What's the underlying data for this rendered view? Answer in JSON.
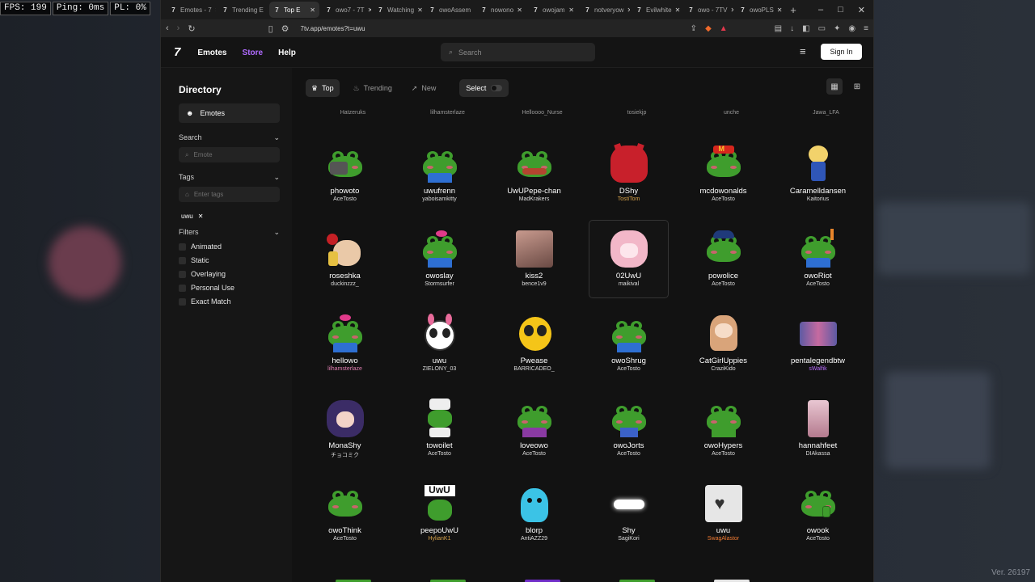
{
  "hud": {
    "fps": "FPS: 199",
    "ping": "Ping: 0ms",
    "pl": "PL: 0%"
  },
  "version": "Ver. 26197",
  "browser": {
    "tabs": [
      "Emotes - 7",
      "Trending E",
      "Top E",
      "owo7 - 7T",
      "Watching",
      "owoAssem",
      "nowono",
      "owojam",
      "notveryow",
      "Evilwhite",
      "owo - 7TV",
      "owoPLS"
    ],
    "active_tab_index": 2,
    "url": "7tv.app/emotes?t=uwu"
  },
  "site": {
    "logo": "7",
    "nav": [
      "Emotes",
      "Store",
      "Help"
    ],
    "search_placeholder": "Search",
    "sign_in": "Sign In"
  },
  "sidebar": {
    "title": "Directory",
    "item": "Emotes",
    "search_label": "Search",
    "search_placeholder": "Emote",
    "tags_label": "Tags",
    "tags_placeholder": "Enter tags",
    "tag_chip": "uwu",
    "filters_label": "Filters",
    "filters": [
      "Animated",
      "Static",
      "Overlaying",
      "Personal Use",
      "Exact Match"
    ]
  },
  "content": {
    "tabs": [
      "Top",
      "Trending",
      "New"
    ],
    "select_label": "Select",
    "cut_row": [
      "Hatzeruks",
      "lilhamsterlaze",
      "Helloooo_Nurse",
      "tosiekjp",
      "unche",
      "Jawa_LFA"
    ],
    "emotes": [
      {
        "name": "phowoto",
        "author": "AceTosto",
        "style": ""
      },
      {
        "name": "uwufrenn",
        "author": "yaboisamkitty",
        "style": ""
      },
      {
        "name": "UwUPepe-chan",
        "author": "MadKrakers",
        "style": ""
      },
      {
        "name": "DShy",
        "author": "TostiTom",
        "style": "gold"
      },
      {
        "name": "mcdowonalds",
        "author": "AceTosto",
        "style": ""
      },
      {
        "name": "Caramelldansen",
        "author": "Kaitorius",
        "style": ""
      },
      {
        "name": "roseshka",
        "author": "duckinzzz_",
        "style": ""
      },
      {
        "name": "owoslay",
        "author": "Stormsurfer",
        "style": ""
      },
      {
        "name": "kiss2",
        "author": "bence1v9",
        "style": ""
      },
      {
        "name": "02UwU",
        "author": "maikival",
        "style": ""
      },
      {
        "name": "powolice",
        "author": "AceTosto",
        "style": ""
      },
      {
        "name": "owoRiot",
        "author": "AceTosto",
        "style": ""
      },
      {
        "name": "hellowo",
        "author": "lilhamsterlaze",
        "style": "pink"
      },
      {
        "name": "uwu",
        "author": "ZIELONY_03",
        "style": ""
      },
      {
        "name": "Pwease",
        "author": "BARRICADEO_",
        "style": ""
      },
      {
        "name": "owoShrug",
        "author": "AceTosto",
        "style": ""
      },
      {
        "name": "CatGirlUppies",
        "author": "CraziKido",
        "style": ""
      },
      {
        "name": "pentalegendbtw",
        "author": "sWalfik",
        "style": "purple"
      },
      {
        "name": "MonaShy",
        "author": "チョコミク",
        "style": ""
      },
      {
        "name": "towoilet",
        "author": "AceTosto",
        "style": ""
      },
      {
        "name": "loveowo",
        "author": "AceTosto",
        "style": ""
      },
      {
        "name": "owoJorts",
        "author": "AceTosto",
        "style": ""
      },
      {
        "name": "owoHypers",
        "author": "AceTosto",
        "style": ""
      },
      {
        "name": "hannahfeet",
        "author": "DIAkassa",
        "style": ""
      },
      {
        "name": "owoThink",
        "author": "AceTosto",
        "style": ""
      },
      {
        "name": "peepoUwU",
        "author": "HylianK1",
        "style": "gold"
      },
      {
        "name": "blorp",
        "author": "AntiAZZ29",
        "style": ""
      },
      {
        "name": "Shy",
        "author": "SagiKori",
        "style": ""
      },
      {
        "name": "uwu",
        "author": "SwagAlastor",
        "style": "orange"
      },
      {
        "name": "owook",
        "author": "AceTosto",
        "style": ""
      }
    ],
    "peepo_label": "UwU"
  }
}
